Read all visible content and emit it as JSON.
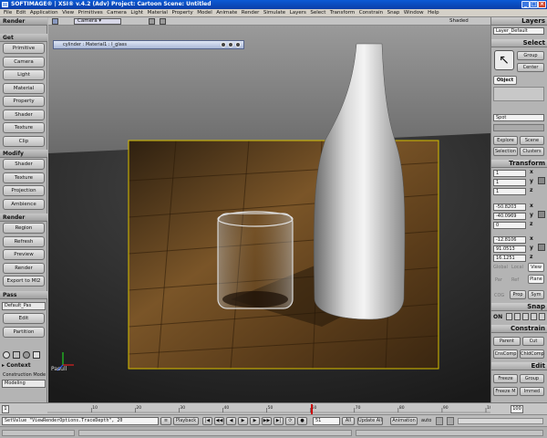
{
  "window": {
    "title": "SOFTIMAGE® | XSI® v.4.2 (Adv) Project: Cartoon   Scene: Untitled"
  },
  "menubar": [
    "File",
    "Edit",
    "Application",
    "View",
    "Primitives",
    "Camera",
    "Light",
    "Material",
    "Property",
    "Model",
    "Animate",
    "Render",
    "Simulate",
    "Layers",
    "Select",
    "Transform",
    "Constrain",
    "Snap",
    "Window",
    "Help"
  ],
  "left_panel": {
    "header_render": "Render",
    "get_label": "Get",
    "get_items": [
      "Primitive",
      "Camera",
      "Light",
      "Material",
      "Property",
      "Shader",
      "Texture",
      "Clip"
    ],
    "modify_label": "Modify",
    "modify_items": [
      "Shader",
      "Texture",
      "Projection",
      "Ambience"
    ],
    "render_label": "Render",
    "render_items": [
      "Region",
      "Refresh",
      "Preview",
      "Render",
      "Export to MI2"
    ],
    "pass_label": "Pass",
    "pass_value": "Default_Pas",
    "pass_items": [
      "Edit",
      "Partition"
    ],
    "context_label": "Context",
    "construction_mode_label": "Construction Mode",
    "construction_mode_value": "Modeling"
  },
  "viewport": {
    "camera_label": "Camera",
    "shaded_label": "Shaded",
    "render_region_title": "cylinder : Material1 : I_glass",
    "position_label": "Pasull"
  },
  "right_panel": {
    "layers_label": "Layers",
    "layer_value": "Layer_Default",
    "select_label": "Select",
    "group_label": "Group",
    "center_label": "Center",
    "object_label": "Object",
    "spot_value": "Spot",
    "explore_label": "Explore",
    "scene_label": "Scene",
    "selection_label": "Selection",
    "clusters_label": "Clusters",
    "transform_label": "Transform",
    "scale_values": [
      "1",
      "1",
      "1"
    ],
    "rotate_values": [
      "-50.8203",
      "-40.0969",
      "0"
    ],
    "translate_values": [
      "-12.8106",
      "91.0513",
      "16.1251"
    ],
    "axes": [
      "x",
      "y",
      "z"
    ],
    "global_label": "Global",
    "local_label": "Local",
    "view_label": "View",
    "par_label": "Par",
    "ref_label": "Ref",
    "plane_label": "Plane",
    "cog_label": "COG",
    "prop_label": "Prop",
    "sym_label": "Sym",
    "snap_label": "Snap",
    "snap_on": "ON",
    "constrain_label": "Constrain",
    "parent_label": "Parent",
    "cut_label": "Cut",
    "cnscomp_label": "CnsComp",
    "chldcomp_label": "ChldComp",
    "edit_label": "Edit",
    "freeze_label": "Freeze",
    "group2_label": "Group",
    "freeze_m_label": "Freeze M",
    "immed_label": "Immed"
  },
  "timeline": {
    "start": "1",
    "end": "100",
    "ticks": [
      "10",
      "20",
      "30",
      "40",
      "50",
      "60",
      "70",
      "80",
      "90",
      "100"
    ]
  },
  "command": {
    "text": "SetValue \"ViewRenderOptions.TraceDepth\", 20",
    "playback_label": "Playback",
    "current_frame": "51",
    "all_label": "All",
    "update_label": "Update All",
    "animation_label": "Animation",
    "auto_label": "auto"
  },
  "colors": {
    "titlebar": "#0a4bc4",
    "selection_frame": "#d8c000",
    "timeline_marker": "#cc0000"
  }
}
